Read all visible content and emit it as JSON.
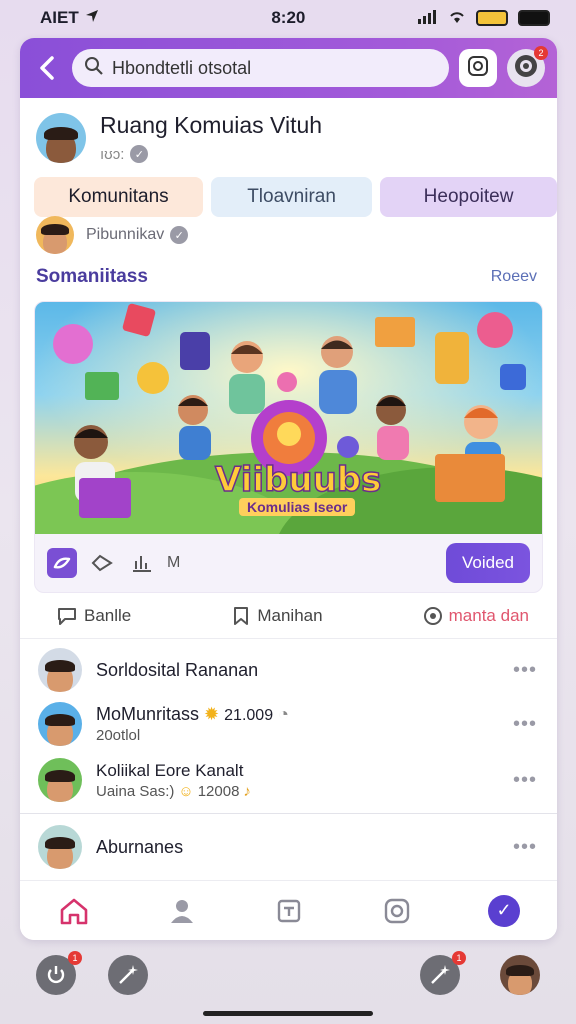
{
  "status_bar": {
    "carrier": "AIET",
    "time": "8:20"
  },
  "header": {
    "search_value": "Hbondtetli otsotal"
  },
  "community": {
    "title": "Ruang Komuias Vituh",
    "subtitle": "ıʊɔ:"
  },
  "tabs": [
    {
      "label": "Komunitans"
    },
    {
      "label": "Tloavniran"
    },
    {
      "label": "Heopoitew"
    }
  ],
  "poster": {
    "name": "Pibunnikav"
  },
  "section": {
    "title": "Somaniitass",
    "link": "Roeev"
  },
  "banner": {
    "title": "Viibuubs",
    "subtitle": "Komulias Iseor"
  },
  "post_actions": {
    "counter_label": "M",
    "verified_label": "Voided"
  },
  "reactions": [
    {
      "label": "Banlle",
      "icon": "comment-icon"
    },
    {
      "label": "Manihan",
      "icon": "bookmark-icon"
    },
    {
      "label": "manta dan",
      "icon": "share-icon",
      "color": "#e0566e"
    }
  ],
  "list": [
    {
      "title": "Sorldosital Rananan",
      "sub": ""
    },
    {
      "title": "MoMunritass",
      "sub_inline": "21.009",
      "sub": "20otlol"
    },
    {
      "title": "Koliikal Eore Kanalt",
      "sub": "Uaina Sas:)",
      "sub_inline": "12008"
    },
    {
      "title": "Aburnanes",
      "sub": ""
    }
  ],
  "colors": {
    "brand_purple": "#8a4fd8",
    "accent_red": "#e0566e",
    "badge_red": "#e53935"
  }
}
